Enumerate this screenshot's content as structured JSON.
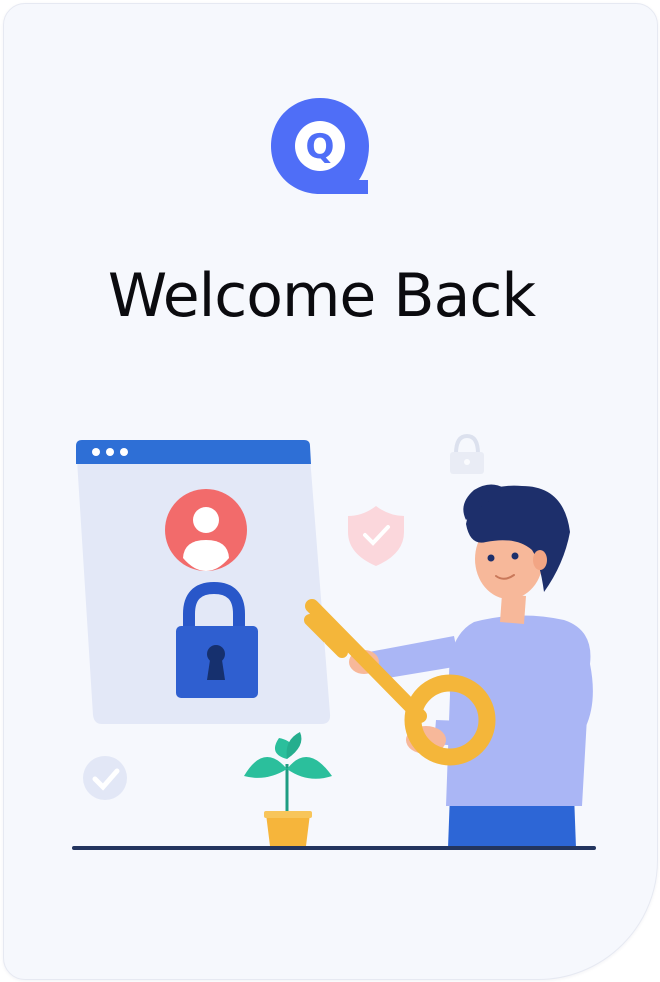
{
  "app": {
    "logo_letter": "Q",
    "brand_color": "#4f6ef7"
  },
  "header": {
    "title": "Welcome Back"
  },
  "illustration": {
    "description_icons": [
      "browser-window-icon",
      "user-avatar-icon",
      "padlock-icon",
      "shield-check-icon",
      "small-lock-icon",
      "check-circle-icon",
      "potted-plant-icon",
      "key-icon",
      "person-figure"
    ],
    "colors": {
      "window_bar": "#2e6fd6",
      "window_body": "#e6ebf8",
      "avatar": "#f26b6b",
      "padlock": "#2957c9",
      "key": "#f4b63a",
      "shirt": "#aab6f5",
      "pants": "#2d66d6",
      "hair": "#1d2f6b",
      "skin": "#f7b89a",
      "plant": "#2bbf9c",
      "pot": "#f6b53b",
      "floor": "#23355f"
    }
  }
}
